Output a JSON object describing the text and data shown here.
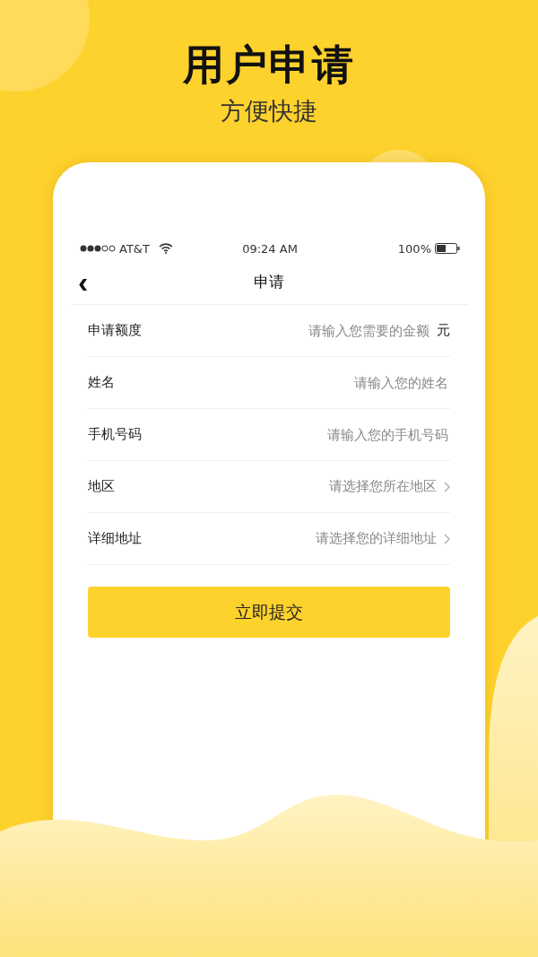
{
  "headline": {
    "title": "用户申请",
    "subtitle": "方便快捷"
  },
  "status_bar": {
    "carrier": "AT&T",
    "time": "09:24 AM",
    "battery": "100%"
  },
  "nav": {
    "back": "‹",
    "title": "申请"
  },
  "fields": [
    {
      "kind": "input",
      "label": "申请额度",
      "placeholder": "请输入您需要的金额",
      "unit": "元"
    },
    {
      "kind": "input",
      "label": "姓名",
      "placeholder": "请输入您的姓名"
    },
    {
      "kind": "input",
      "label": "手机号码",
      "placeholder": "请输入您的手机号码"
    },
    {
      "kind": "select",
      "label": "地区",
      "placeholder": "请选择您所在地区"
    },
    {
      "kind": "select",
      "label": "详细地址",
      "placeholder": "请选择您的详细地址"
    }
  ],
  "submit": "立即提交"
}
